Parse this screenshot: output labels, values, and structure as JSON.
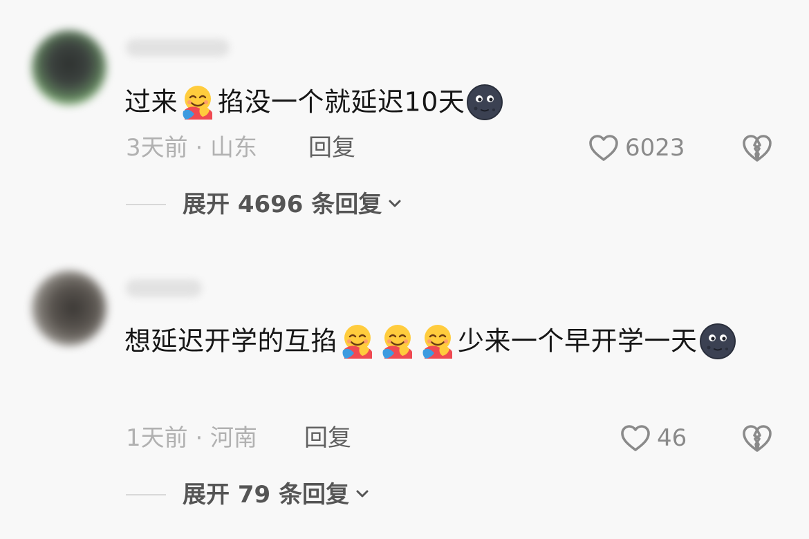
{
  "comments": [
    {
      "content_parts": [
        {
          "type": "text",
          "value": "过来"
        },
        {
          "type": "emoji",
          "icon": "hugging-face-emoji"
        },
        {
          "type": "text",
          "value": "掐没一个就延迟10天"
        },
        {
          "type": "emoji",
          "icon": "new-moon-face-emoji"
        }
      ],
      "time_location": "3天前 · 山东",
      "reply_label": "回复",
      "like_count": "6023",
      "expand_label": "展开 4696 条回复"
    },
    {
      "content_parts": [
        {
          "type": "text",
          "value": "想延迟开学的互掐"
        },
        {
          "type": "emoji",
          "icon": "hugging-face-emoji"
        },
        {
          "type": "emoji",
          "icon": "hugging-face-emoji"
        },
        {
          "type": "emoji",
          "icon": "hugging-face-emoji"
        },
        {
          "type": "text",
          "value": "少来一个早开学一天"
        },
        {
          "type": "emoji",
          "icon": "new-moon-face-emoji"
        }
      ],
      "time_location": "1天前 · 河南",
      "reply_label": "回复",
      "like_count": "46",
      "expand_label": "展开 79 条回复"
    }
  ],
  "colors": {
    "background": "#f8f8f8",
    "text_primary": "#161616",
    "text_meta": "#b1b1b1",
    "text_reply": "#606060",
    "icon_gray": "#8a8a8a"
  }
}
